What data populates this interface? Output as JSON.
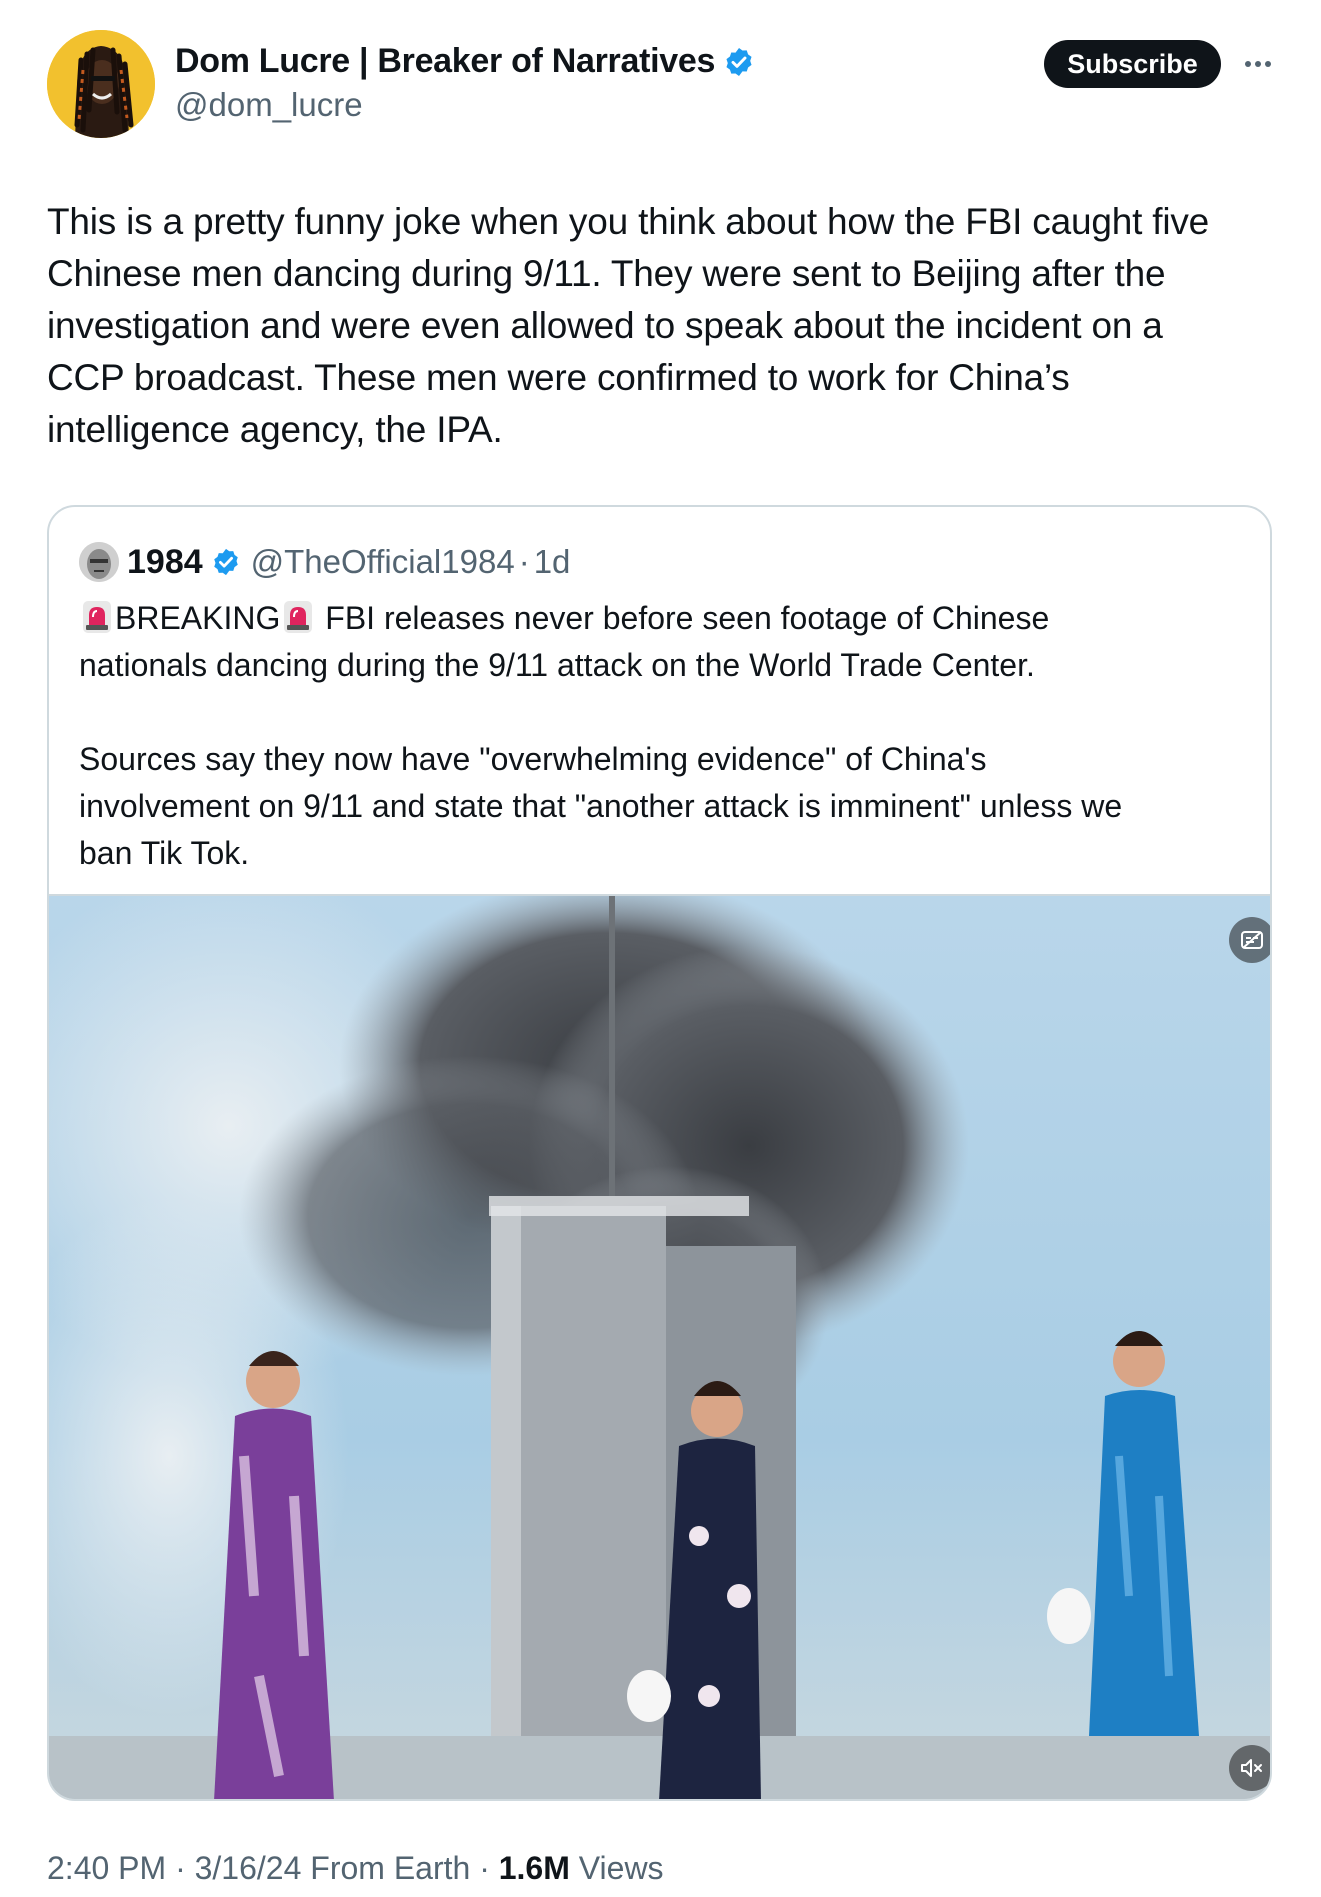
{
  "author": {
    "display_name": "Dom Lucre | Breaker of Narratives",
    "handle": "@dom_lucre",
    "avatar_icon": "avatar-portrait",
    "verified_color": "#1d9bf0"
  },
  "actions": {
    "subscribe_label": "Subscribe",
    "more_icon": "ellipsis-icon"
  },
  "post": {
    "text": "This is a pretty funny joke when you think about how the FBI caught five\nChinese men dancing during 9/11. They were sent to Beijing after the\ninvestigation and were even allowed to speak about the incident on a\nCCP broadcast. These men were confirmed to work for China’s\nintelligence agency, the IPA."
  },
  "quote": {
    "name": "1984",
    "handle": "@TheOfficial1984",
    "separator": "·",
    "time": "1d",
    "breaking": "BREAKING",
    "line1_rest": "FBI releases never before seen footage of Chinese",
    "line2": "nationals dancing during the 9/11 attack on the World Trade Center.",
    "line3": "Sources say they now have \"overwhelming evidence\" of China's",
    "line4": "involvement on 9/11 and state that \"another attack is imminent\" unless we",
    "line5": "ban Tik Tok.",
    "media": {
      "captions_icon": "captions-icon",
      "mute_icon": "muted-speaker-icon"
    }
  },
  "meta": {
    "time": "2:40 PM",
    "sep1": "·",
    "date": "3/16/24",
    "location": "From Earth",
    "sep2": "·",
    "views_count": "1.6M",
    "views_label": "Views"
  },
  "colors": {
    "text": "#0f1419",
    "secondary": "#536471",
    "border": "#cfd9de",
    "accent": "#1d9bf0"
  }
}
